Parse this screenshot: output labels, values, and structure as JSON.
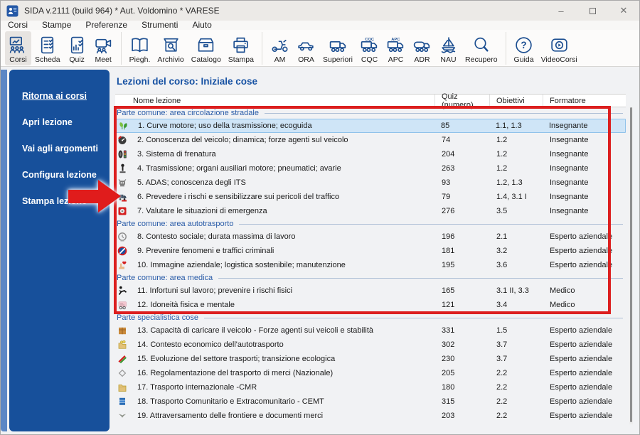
{
  "window": {
    "title": "SIDA v.2111 (build 964) * Aut. Voldomino * VARESE",
    "controls": {
      "minimize": "minimize",
      "maximize": "maximize",
      "close": "close"
    }
  },
  "menu": {
    "items": [
      "Corsi",
      "Stampe",
      "Preferenze",
      "Strumenti",
      "Aiuto"
    ]
  },
  "toolbar": {
    "groups": [
      {
        "buttons": [
          {
            "label": "Corsi",
            "icon": "corsi",
            "selected": true
          },
          {
            "label": "Scheda",
            "icon": "scheda",
            "selected": false
          },
          {
            "label": "Quiz",
            "icon": "quiz",
            "selected": false
          },
          {
            "label": "Meet",
            "icon": "meet",
            "selected": false
          }
        ]
      },
      {
        "buttons": [
          {
            "label": "Piegh.",
            "icon": "piegh",
            "selected": false
          },
          {
            "label": "Archivio",
            "icon": "archivio",
            "selected": false
          },
          {
            "label": "Catalogo",
            "icon": "catalogo",
            "selected": false
          },
          {
            "label": "Stampa",
            "icon": "stampa",
            "selected": false
          }
        ]
      },
      {
        "buttons": [
          {
            "label": "AM",
            "icon": "am",
            "selected": false
          },
          {
            "label": "ORA",
            "icon": "ora",
            "selected": false
          },
          {
            "label": "Superiori",
            "icon": "truck",
            "selected": false
          },
          {
            "label": "CQC",
            "icon": "cqc",
            "selected": false
          },
          {
            "label": "APC",
            "icon": "apc",
            "selected": false
          },
          {
            "label": "ADR",
            "icon": "adr",
            "selected": false
          },
          {
            "label": "NAU",
            "icon": "nau",
            "selected": false
          },
          {
            "label": "Recupero",
            "icon": "recupero",
            "selected": false
          }
        ]
      },
      {
        "buttons": [
          {
            "label": "Guida",
            "icon": "guida",
            "selected": false
          },
          {
            "label": "VideoCorsi",
            "icon": "videocorsi",
            "selected": false
          }
        ]
      }
    ]
  },
  "sidebar": {
    "items": [
      {
        "label": "Ritorna ai corsi",
        "underline": true
      },
      {
        "label": "Apri lezione",
        "underline": false
      },
      {
        "label": "Vai agli argomenti",
        "underline": false
      },
      {
        "label": "Configura lezione",
        "underline": false
      },
      {
        "label": "Stampa lezione",
        "underline": false
      }
    ]
  },
  "content": {
    "title": "Lezioni del corso: Iniziale cose",
    "table": {
      "columns": [
        "Nome lezione",
        "Quiz (numero)",
        "Obiettivi",
        "Formatore"
      ],
      "sections": [
        {
          "title": "Parte comune: area circolazione stradale",
          "rows": [
            {
              "name": "1. Curve motore; uso della trasmissione; ecoguida",
              "quiz": "85",
              "obiettivi": "1.1, 1.3",
              "formatore": "Insegnante",
              "icon": "eco",
              "selected": true
            },
            {
              "name": "2. Conoscenza del veicolo; dinamica; forze agenti sul veicolo",
              "quiz": "74",
              "obiettivi": "1.2",
              "formatore": "Insegnante",
              "icon": "tach",
              "selected": false
            },
            {
              "name": "3. Sistema di frenatura",
              "quiz": "204",
              "obiettivi": "1.2",
              "formatore": "Insegnante",
              "icon": "tire",
              "selected": false
            },
            {
              "name": "4. Trasmissione; organi ausiliari motore; pneumatici; avarie",
              "quiz": "263",
              "obiettivi": "1.2",
              "formatore": "Insegnante",
              "icon": "shift",
              "selected": false
            },
            {
              "name": "5. ADAS; conoscenza degli ITS",
              "quiz": "93",
              "obiettivi": "1.2, 1.3",
              "formatore": "Insegnante",
              "icon": "adas",
              "selected": false
            },
            {
              "name": "6. Prevedere i rischi e sensibilizzare sui pericoli del traffico",
              "quiz": "79",
              "obiettivi": "1.4, 3.1 I",
              "formatore": "Insegnante",
              "icon": "truckrisk",
              "selected": false
            },
            {
              "name": "7. Valutare le situazioni di emergenza",
              "quiz": "276",
              "obiettivi": "3.5",
              "formatore": "Insegnante",
              "icon": "emergency",
              "selected": false
            }
          ]
        },
        {
          "title": "Parte comune: area autotrasporto",
          "rows": [
            {
              "name": "8. Contesto sociale; durata massima di lavoro",
              "quiz": "196",
              "obiettivi": "2.1",
              "formatore": "Esperto aziendale",
              "icon": "clock",
              "selected": false
            },
            {
              "name": "9. Prevenire fenomeni e traffici criminali",
              "quiz": "181",
              "obiettivi": "3.2",
              "formatore": "Esperto aziendale",
              "icon": "noentry",
              "selected": false
            },
            {
              "name": "10. Immagine aziendale; logistica sostenibile; manutenzione",
              "quiz": "195",
              "obiettivi": "3.6",
              "formatore": "Esperto aziendale",
              "icon": "handheart",
              "selected": false
            }
          ]
        },
        {
          "title": "Parte comune: area medica",
          "rows": [
            {
              "name": "11. Infortuni sul lavoro; prevenire i rischi fisici",
              "quiz": "165",
              "obiettivi": "3.1 II, 3.3",
              "formatore": "Medico",
              "icon": "fitness",
              "selected": false
            },
            {
              "name": "12. Idoneità fisica e mentale",
              "quiz": "121",
              "obiettivi": "3.4",
              "formatore": "Medico",
              "icon": "idcard",
              "selected": false
            }
          ]
        },
        {
          "title": "Parte specialistica cose",
          "rows": [
            {
              "name": "13. Capacità di caricare il veicolo - Forze agenti sui veicoli e stabilità",
              "quiz": "331",
              "obiettivi": "1.5",
              "formatore": "Esperto aziendale",
              "icon": "cargo",
              "selected": false
            },
            {
              "name": "14. Contesto economico dell'autotrasporto",
              "quiz": "302",
              "obiettivi": "3.7",
              "formatore": "Esperto aziendale",
              "icon": "economy",
              "selected": false
            },
            {
              "name": "15. Evoluzione del settore trasporti; transizione ecologica",
              "quiz": "230",
              "obiettivi": "3.7",
              "formatore": "Esperto aziendale",
              "icon": "ecotrans",
              "selected": false
            },
            {
              "name": "16. Regolamentazione del trasporto di merci (Nazionale)",
              "quiz": "205",
              "obiettivi": "2.2",
              "formatore": "Esperto aziendale",
              "icon": "diamond",
              "selected": false
            },
            {
              "name": "17. Trasporto internazionale -CMR",
              "quiz": "180",
              "obiettivi": "2.2",
              "formatore": "Esperto aziendale",
              "icon": "folder",
              "selected": false
            },
            {
              "name": "18. Trasporto Comunitario e Extracomunitario - CEMT",
              "quiz": "315",
              "obiettivi": "2.2",
              "formatore": "Esperto aziendale",
              "icon": "books",
              "selected": false
            },
            {
              "name": "19. Attraversamento delle frontiere e documenti merci",
              "quiz": "203",
              "obiettivi": "2.2",
              "formatore": "Esperto aziendale",
              "icon": "bird",
              "selected": false
            }
          ]
        }
      ]
    }
  },
  "colors": {
    "sidebar_blue": "#17509b",
    "title_blue": "#1752a3",
    "section_blue": "#2a5ca8",
    "toolbar_icon_blue": "#1d4f91",
    "selection_blue": "#cfe5f7",
    "annotation_red": "#dc1f1f"
  }
}
